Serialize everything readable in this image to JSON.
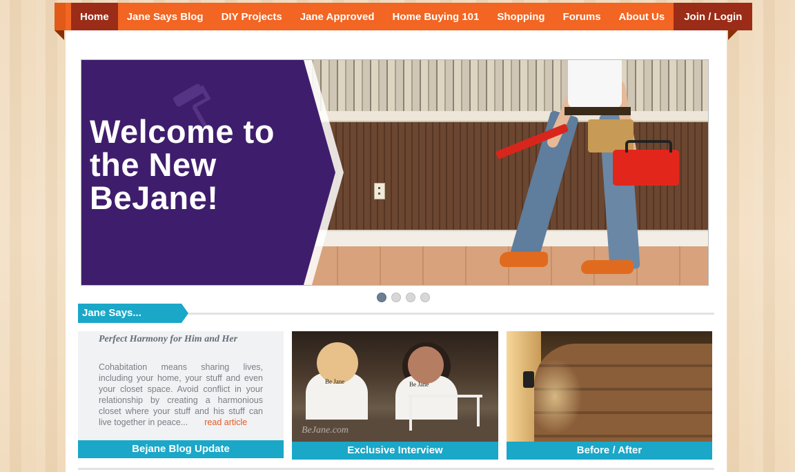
{
  "nav": {
    "items": [
      {
        "label": "Home",
        "active": true
      },
      {
        "label": "Jane Says Blog"
      },
      {
        "label": "DIY Projects"
      },
      {
        "label": "Jane Approved"
      },
      {
        "label": "Home Buying 101"
      },
      {
        "label": "Shopping"
      },
      {
        "label": "Forums"
      },
      {
        "label": "About Us"
      }
    ],
    "login": "Join / Login"
  },
  "hero": {
    "title": "Welcome to the New BeJane!",
    "slides": 4,
    "active_slide": 1
  },
  "section": {
    "title": "Jane Says..."
  },
  "cards": [
    {
      "type": "blog",
      "title": "Perfect Harmony for Him and Her",
      "excerpt": "Cohabitation means sharing lives, including your home, your stuff and even your closet space. Avoid conflict in your relationship by creating a harmonious closet where your stuff and his stuff can live together in peace...",
      "link": "read article",
      "label": "Bejane Blog Update"
    },
    {
      "type": "video",
      "shirt_text": "Be Jane",
      "watermark": "BeJane.com",
      "label": "Exclusive Interview"
    },
    {
      "type": "photo",
      "label": "Before / After"
    }
  ],
  "colors": {
    "nav_bg": "#f26522",
    "nav_active": "#9b2c17",
    "hero_purple": "#3f1d6d",
    "accent_teal": "#1aa7c8",
    "link_orange": "#e35a24"
  }
}
